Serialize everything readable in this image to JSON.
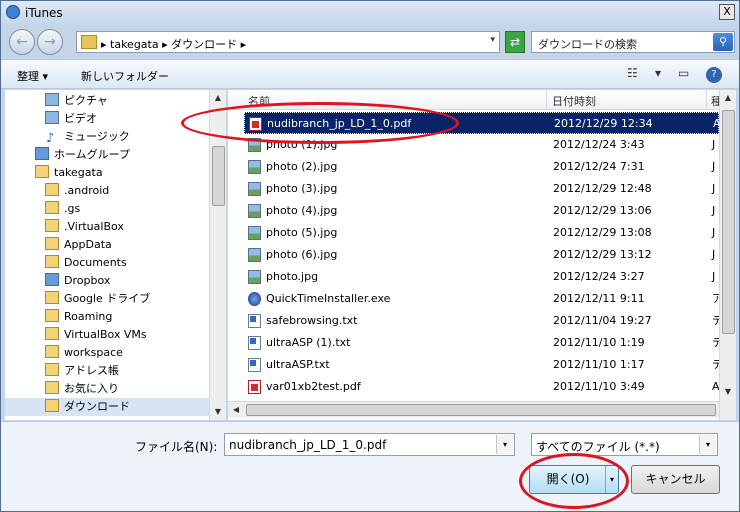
{
  "window": {
    "title": "iTunes",
    "close_label": "X"
  },
  "address": {
    "path": "▸ takegata ▸ ダウンロード ▸",
    "dropdown_glyph": "▾",
    "search_placeholder": "ダウンロードの検索",
    "back_glyph": "←",
    "forward_glyph": "→",
    "refresh_glyph": "⇄",
    "search_glyph": "⚲"
  },
  "toolbar": {
    "organize": "整理",
    "organize_arrow": "▾",
    "new_folder": "新しいフォルダー",
    "view_glyph": "☷",
    "view_arrow": "▾",
    "preview_glyph": "▭",
    "help_glyph": "?"
  },
  "sidebar": {
    "items": [
      {
        "label": "ピクチャ",
        "icon": "pictures-icon"
      },
      {
        "label": "ビデオ",
        "icon": "video-icon"
      },
      {
        "label": "ミュージック",
        "icon": "music-icon"
      },
      {
        "label": "ホームグループ",
        "icon": "homegroup-icon"
      },
      {
        "label": "takegata",
        "icon": "user-folder-icon"
      },
      {
        "label": ".android",
        "icon": "folder-icon"
      },
      {
        "label": ".gs",
        "icon": "folder-icon"
      },
      {
        "label": ".VirtualBox",
        "icon": "folder-icon"
      },
      {
        "label": "AppData",
        "icon": "folder-icon"
      },
      {
        "label": "Documents",
        "icon": "folder-icon"
      },
      {
        "label": "Dropbox",
        "icon": "dropbox-folder-icon"
      },
      {
        "label": "Google ドライブ",
        "icon": "folder-icon"
      },
      {
        "label": "Roaming",
        "icon": "folder-icon"
      },
      {
        "label": "VirtualBox VMs",
        "icon": "folder-icon"
      },
      {
        "label": "workspace",
        "icon": "folder-icon"
      },
      {
        "label": "アドレス帳",
        "icon": "contacts-folder-icon"
      },
      {
        "label": "お気に入り",
        "icon": "favorites-folder-icon"
      },
      {
        "label": "ダウンロード",
        "icon": "downloads-folder-icon",
        "selected": true
      }
    ]
  },
  "columns": {
    "name": "名前",
    "date": "日付時刻",
    "type": "種"
  },
  "files": [
    {
      "name": "nudibranch_jp_LD_1_0.pdf",
      "date": "2012/12/29 12:34",
      "type": "A",
      "icon": "pdf-file-icon",
      "selected": true
    },
    {
      "name": "photo (1).jpg",
      "date": "2012/12/24 3:43",
      "type": "J",
      "icon": "image-file-icon"
    },
    {
      "name": "photo (2).jpg",
      "date": "2012/12/24 7:31",
      "type": "J",
      "icon": "image-file-icon"
    },
    {
      "name": "photo (3).jpg",
      "date": "2012/12/29 12:48",
      "type": "J",
      "icon": "image-file-icon"
    },
    {
      "name": "photo (4).jpg",
      "date": "2012/12/29 13:06",
      "type": "J",
      "icon": "image-file-icon"
    },
    {
      "name": "photo (5).jpg",
      "date": "2012/12/29 13:08",
      "type": "J",
      "icon": "image-file-icon"
    },
    {
      "name": "photo (6).jpg",
      "date": "2012/12/29 13:12",
      "type": "J",
      "icon": "image-file-icon"
    },
    {
      "name": "photo.jpg",
      "date": "2012/12/24 3:27",
      "type": "J",
      "icon": "image-file-icon"
    },
    {
      "name": "QuickTimeInstaller.exe",
      "date": "2012/12/11 9:11",
      "type": "ア",
      "icon": "exe-file-icon"
    },
    {
      "name": "safebrowsing.txt",
      "date": "2012/11/04 19:27",
      "type": "テ",
      "icon": "text-file-icon"
    },
    {
      "name": "ultraASP (1).txt",
      "date": "2012/11/10 1:19",
      "type": "テ",
      "icon": "text-file-icon"
    },
    {
      "name": "ultraASP.txt",
      "date": "2012/11/10 1:17",
      "type": "テ",
      "icon": "text-file-icon"
    },
    {
      "name": "var01xb2test.pdf",
      "date": "2012/11/10 3:49",
      "type": "A",
      "icon": "pdf-file-icon"
    }
  ],
  "bottom": {
    "filename_label": "ファイル名(N):",
    "filename_value": "nudibranch_jp_LD_1_0.pdf",
    "filetype_value": "すべてのファイル (*.*)",
    "open_label": "開く(O)",
    "cancel_label": "キャンセル",
    "drop_glyph": "▾"
  },
  "colors": {
    "selection": "#0a246a",
    "annotation": "#e0141e"
  }
}
